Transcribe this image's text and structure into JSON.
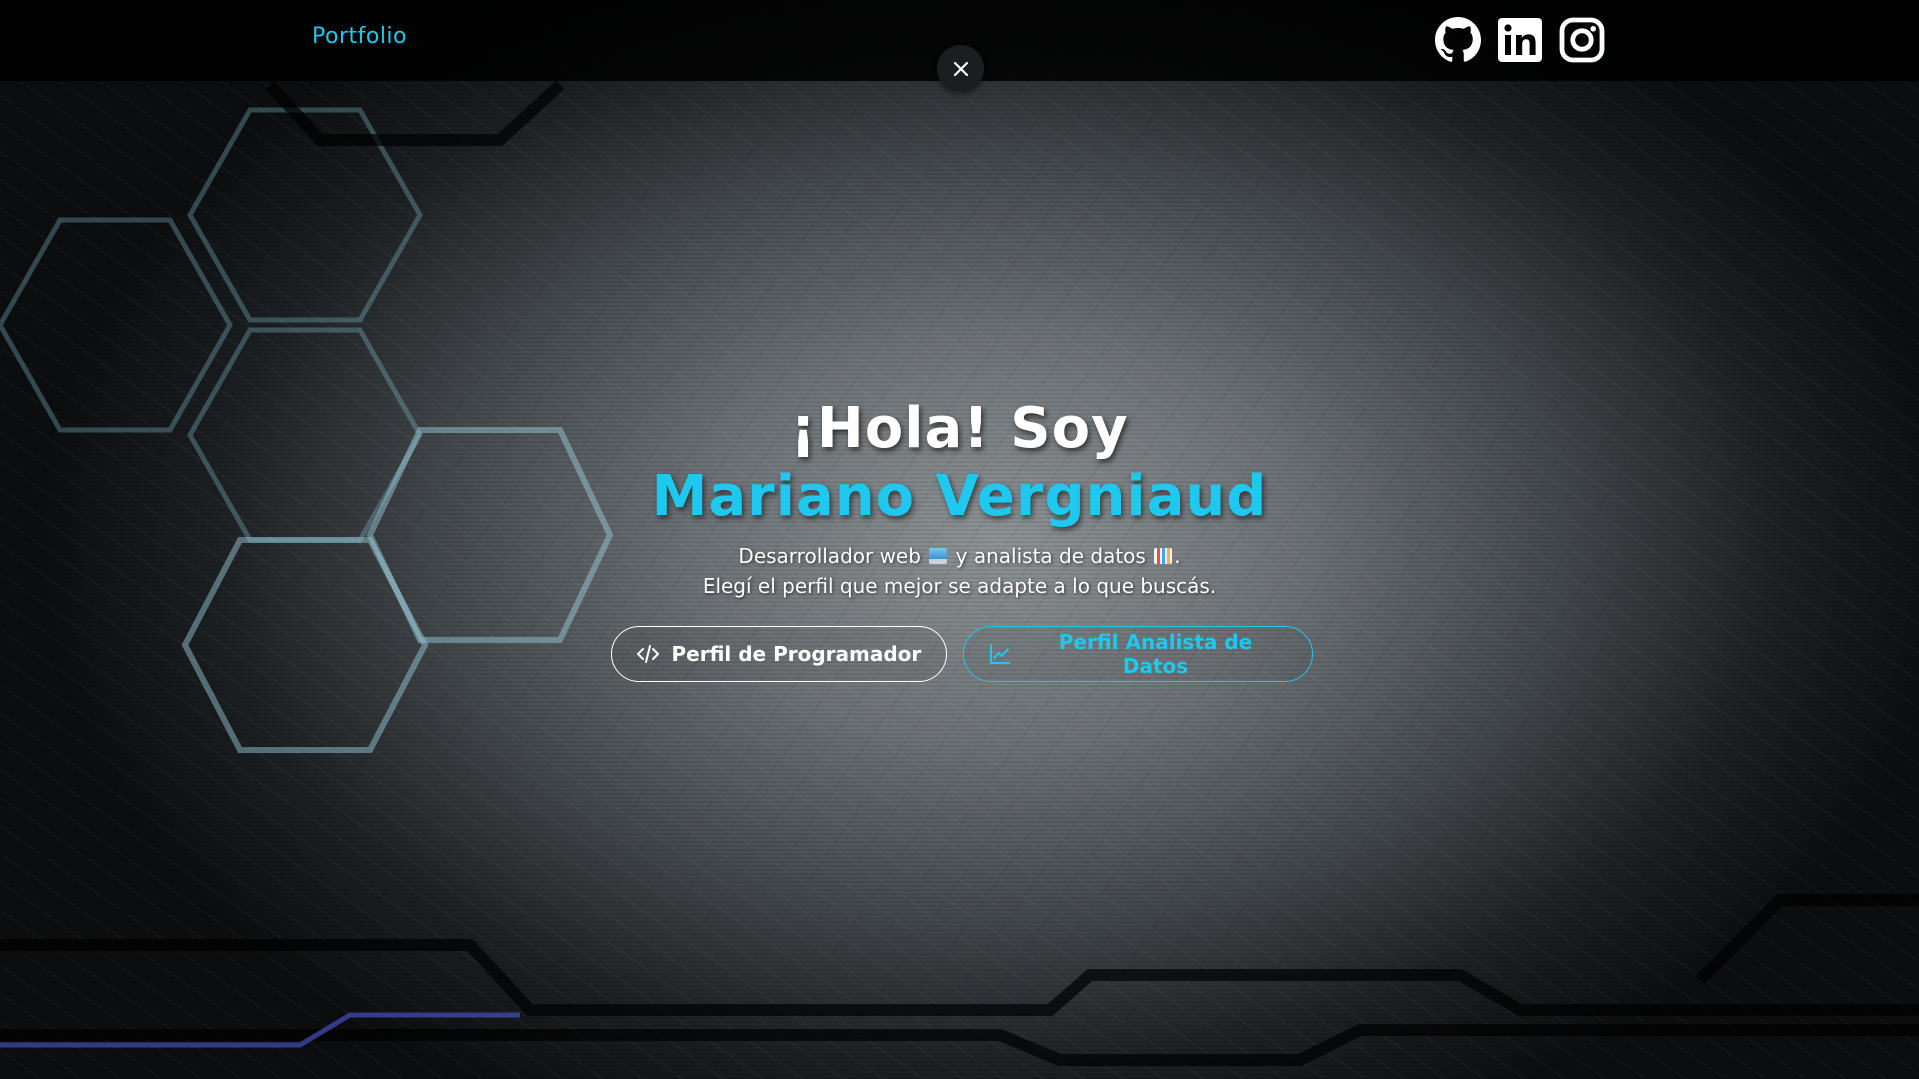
{
  "header": {
    "brand": "Portfolio",
    "social_links": [
      {
        "name": "GitHub",
        "icon": "github-icon"
      },
      {
        "name": "LinkedIn",
        "icon": "linkedin-icon"
      },
      {
        "name": "Instagram",
        "icon": "instagram-icon"
      }
    ],
    "close_icon": "close-icon"
  },
  "hero": {
    "greeting": "¡Hola! Soy",
    "name": "Mariano Vergniaud",
    "desc_line1_a": "Desarrollador web",
    "desc_line1_b": "y analista de datos",
    "desc_line1_c": ".",
    "desc_line2": "Elegí el perfil que mejor se adapte a lo que buscás.",
    "emoji_laptop": "laptop-emoji",
    "emoji_chart": "bar-chart-emoji"
  },
  "buttons": {
    "developer": {
      "label": "Perfil de Programador",
      "icon": "code-icon"
    },
    "data": {
      "label": "Perfil Analista de Datos",
      "icon": "line-chart-icon"
    }
  },
  "colors": {
    "accent": "#1ec8ee",
    "navbar": "#000000",
    "text": "#ffffff"
  }
}
